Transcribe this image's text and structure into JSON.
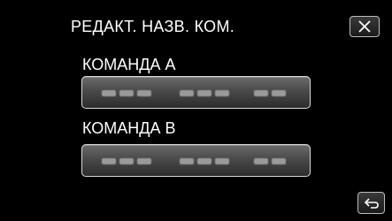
{
  "header": {
    "title": "РЕДАКТ. НАЗВ. КОМ.",
    "close_icon": "close-icon"
  },
  "teams": [
    {
      "label": "КОМАНДА A",
      "value_masked": true
    },
    {
      "label": "КОМАНДА B",
      "value_masked": true
    }
  ],
  "footer": {
    "back_icon": "return-icon"
  },
  "colors": {
    "background": "#000000",
    "text": "#ffffff",
    "field_border": "#d8d8d8"
  }
}
